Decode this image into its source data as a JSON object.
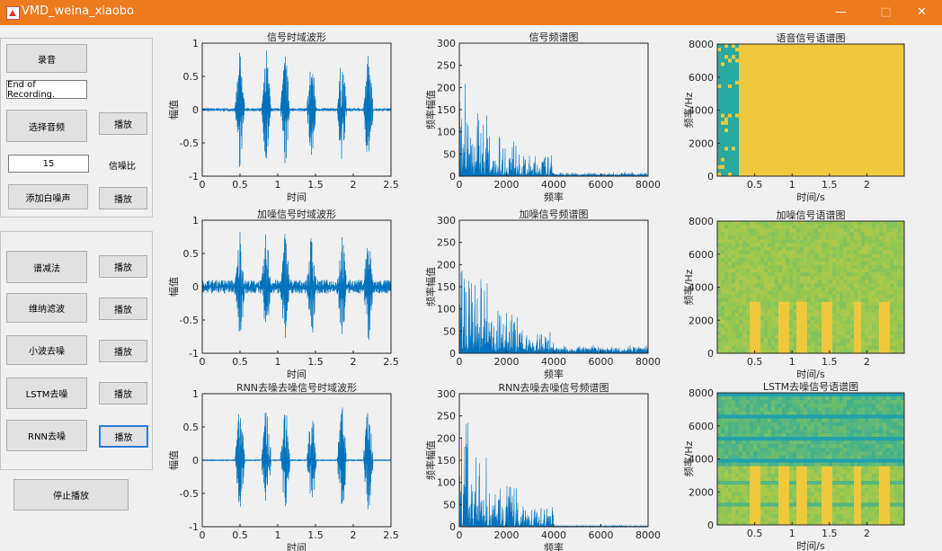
{
  "window": {
    "title": "VMD_weina_xiaobo",
    "min": "—",
    "max": "□",
    "close": "✕"
  },
  "controls": {
    "record": "录音",
    "status": "End of Recording.",
    "select_audio": "选择音频",
    "play": "播放",
    "snr_value": "15",
    "snr_label": "信噪比",
    "add_noise": "添加白噪声",
    "spectral_sub": "谱减法",
    "wiener": "维纳滤波",
    "wavelet": "小波去噪",
    "lstm": "LSTM去噪",
    "rnn": "RNN去噪",
    "stop": "停止播放"
  },
  "plots": {
    "time": [
      {
        "title": "信号时域波形",
        "xlabel": "时间",
        "ylabel": "幅值",
        "noise": 0.02
      },
      {
        "title": "加噪信号时域波形",
        "xlabel": "时间",
        "ylabel": "幅值",
        "noise": 0.1
      },
      {
        "title": "RNN去噪去噪信号时域波形",
        "xlabel": "时间",
        "ylabel": "幅值",
        "noise": 0
      }
    ],
    "time_xticks": [
      "0",
      "0.5",
      "1",
      "1.5",
      "2",
      "2.5"
    ],
    "time_yticks": [
      "1",
      "0.5",
      "0",
      "-0.5",
      "-1"
    ],
    "spec": [
      {
        "title": "信号频谱图",
        "xlabel": "频率",
        "ylabel": "频率幅值",
        "floor": 5
      },
      {
        "title": "加噪信号频谱图",
        "xlabel": "频率",
        "ylabel": "频率幅值",
        "floor": 10
      },
      {
        "title": "RNN去噪去噪信号频谱图",
        "xlabel": "频率",
        "ylabel": "频率幅值",
        "floor": 2
      }
    ],
    "spec_xticks": [
      "0",
      "2000",
      "4000",
      "6000",
      "8000"
    ],
    "spec_yticks": [
      "300",
      "250",
      "200",
      "150",
      "100",
      "50",
      "0"
    ],
    "sgram": [
      {
        "title": "语音信号语谱图",
        "xlabel": "时间/s",
        "ylabel": "频率/Hz"
      },
      {
        "title": "加噪信号语谱图",
        "xlabel": "时间/s",
        "ylabel": "频率/Hz"
      },
      {
        "title": "LSTM去噪信号语谱图",
        "xlabel": "时间/s",
        "ylabel": "频率/Hz"
      }
    ],
    "sgram_xticks": [
      "0.5",
      "1",
      "1.5",
      "2"
    ],
    "sgram_yticks": [
      "8000",
      "6000",
      "4000",
      "2000",
      "0"
    ]
  },
  "chart_data": [
    {
      "type": "line",
      "title": "信号时域波形",
      "xlabel": "时间",
      "ylabel": "幅值",
      "xlim": [
        0,
        2.5
      ],
      "ylim": [
        -1,
        1
      ],
      "bursts": [
        0.5,
        0.85,
        1.1,
        1.45,
        1.85,
        2.2
      ]
    },
    {
      "type": "bar",
      "title": "信号频谱图",
      "xlabel": "频率",
      "ylabel": "频率幅值",
      "xlim": [
        0,
        8000
      ],
      "ylim": [
        0,
        300
      ]
    },
    {
      "type": "heatmap",
      "title": "语音信号语谱图",
      "xlabel": "时间/s",
      "ylabel": "频率/Hz",
      "ylim": [
        0,
        8000
      ]
    }
  ],
  "colors": {
    "line": "#0072bd",
    "accent": "#ec7a1e"
  }
}
